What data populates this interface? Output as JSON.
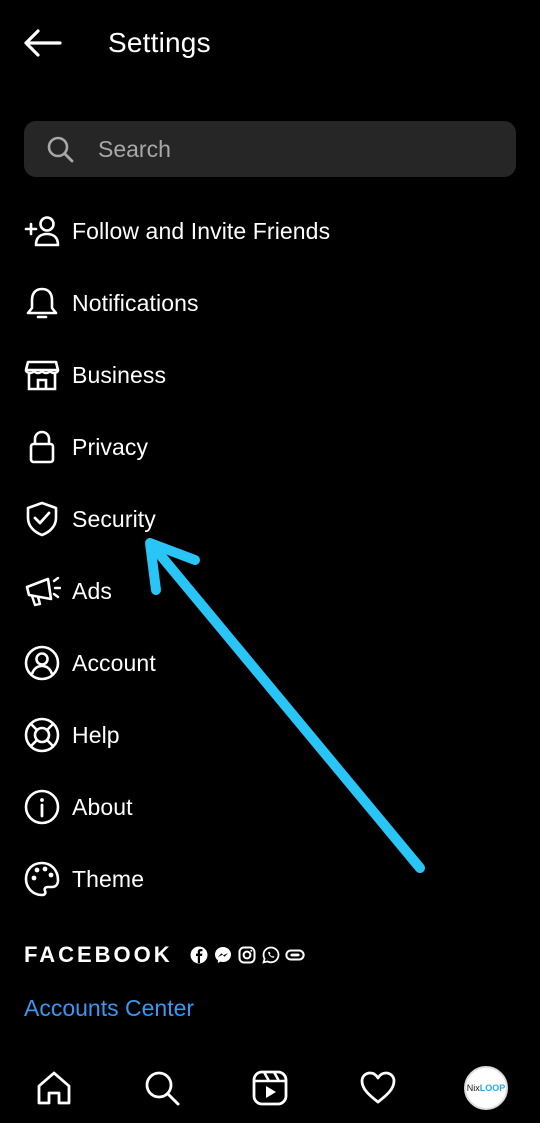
{
  "header": {
    "title": "Settings",
    "back_icon": "arrow-left-icon"
  },
  "search": {
    "placeholder": "Search",
    "value": "",
    "icon": "search-icon"
  },
  "menu": {
    "items": [
      {
        "label": "Follow and Invite Friends",
        "icon": "add-person-icon"
      },
      {
        "label": "Notifications",
        "icon": "bell-icon"
      },
      {
        "label": "Business",
        "icon": "storefront-icon"
      },
      {
        "label": "Privacy",
        "icon": "lock-icon"
      },
      {
        "label": "Security",
        "icon": "shield-check-icon"
      },
      {
        "label": "Ads",
        "icon": "megaphone-icon"
      },
      {
        "label": "Account",
        "icon": "user-circle-icon"
      },
      {
        "label": "Help",
        "icon": "lifebuoy-icon"
      },
      {
        "label": "About",
        "icon": "info-icon"
      },
      {
        "label": "Theme",
        "icon": "palette-icon"
      }
    ]
  },
  "facebook": {
    "title": "FACEBOOK",
    "app_icons": [
      "facebook-icon",
      "messenger-icon",
      "instagram-icon",
      "whatsapp-icon",
      "portal-icon"
    ],
    "accounts_center": "Accounts Center"
  },
  "bottom_nav": {
    "items": [
      "home-icon",
      "search-icon",
      "reels-icon",
      "heart-icon",
      "profile-avatar"
    ],
    "avatar_text_prefix": "Nix",
    "avatar_text_suffix": "LOOP"
  },
  "colors": {
    "background": "#000000",
    "search_bg": "#262626",
    "link": "#3897f0",
    "annotation_arrow": "#29c5f6"
  }
}
